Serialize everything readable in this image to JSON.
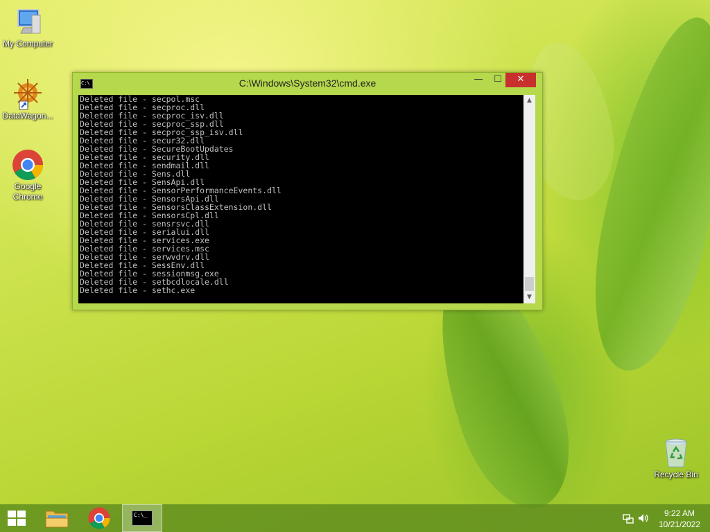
{
  "desktop": {
    "icons": [
      {
        "label": "My Computer"
      },
      {
        "label": "DataWagon..."
      },
      {
        "label": "Google Chrome"
      },
      {
        "label": "Recycle Bin"
      }
    ]
  },
  "window": {
    "title": "C:\\Windows\\System32\\cmd.exe",
    "icon_text": "C:\\",
    "minimize": "—",
    "maximize": "☐",
    "close": "✕",
    "console_lines": [
      "Deleted file - secpol.msc",
      "Deleted file - secproc.dll",
      "Deleted file - secproc_isv.dll",
      "Deleted file - secproc_ssp.dll",
      "Deleted file - secproc_ssp_isv.dll",
      "Deleted file - secur32.dll",
      "Deleted file - SecureBootUpdates",
      "Deleted file - security.dll",
      "Deleted file - sendmail.dll",
      "Deleted file - Sens.dll",
      "Deleted file - SensApi.dll",
      "Deleted file - SensorPerformanceEvents.dll",
      "Deleted file - SensorsApi.dll",
      "Deleted file - SensorsClassExtension.dll",
      "Deleted file - SensorsCpl.dll",
      "Deleted file - sensrsvc.dll",
      "Deleted file - serialui.dll",
      "Deleted file - services.exe",
      "Deleted file - services.msc",
      "Deleted file - serwvdrv.dll",
      "Deleted file - SessEnv.dll",
      "Deleted file - sessionmsg.exe",
      "Deleted file - setbcdlocale.dll",
      "Deleted file - sethc.exe"
    ],
    "scroll_up": "▲",
    "scroll_down": "▼"
  },
  "taskbar": {
    "cmd_icon_text": "C:\\_",
    "clock_time": "9:22 AM",
    "clock_date": "10/21/2022"
  },
  "colors": {
    "close_button": "#c7302c",
    "window_frame": "#b5d84c",
    "console_bg": "#000000",
    "console_text": "#c0c0c0"
  }
}
